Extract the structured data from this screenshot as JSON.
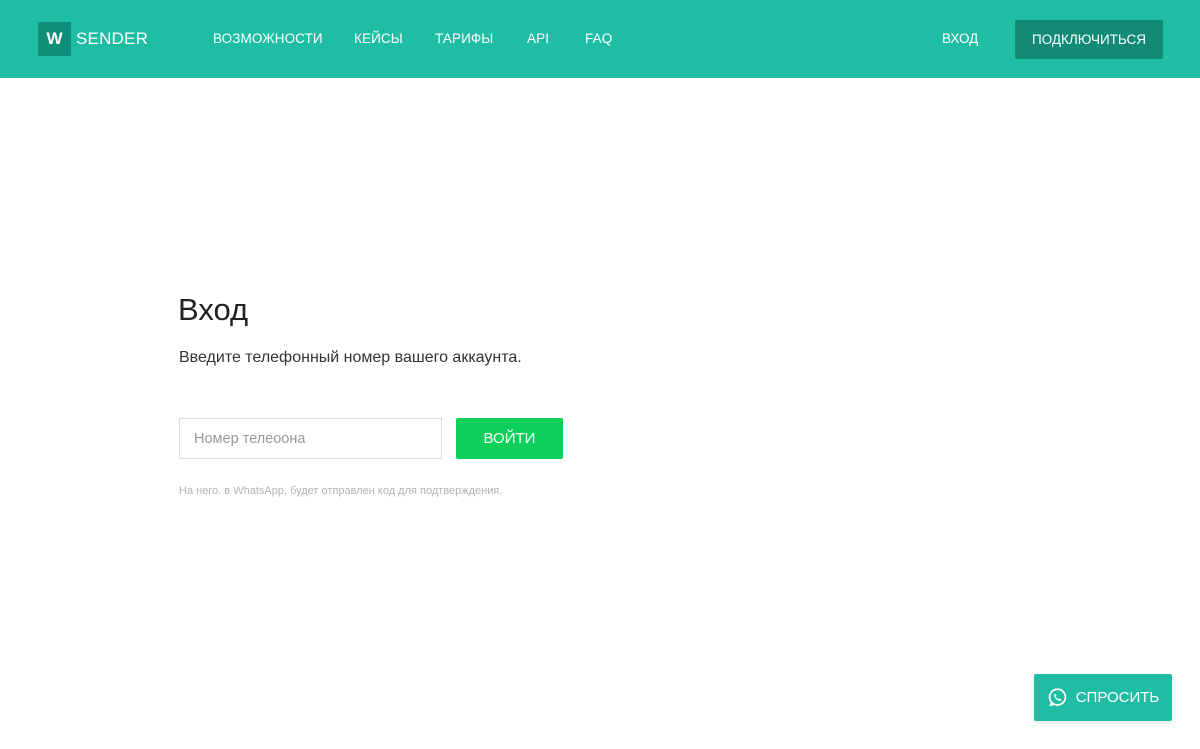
{
  "header": {
    "logo_letter": "W",
    "logo_text": "SENDER",
    "nav": [
      {
        "label": "ВОЗМОЖНОСТИ"
      },
      {
        "label": "КЕЙСЫ"
      },
      {
        "label": "ТАРИФЫ"
      },
      {
        "label": "API"
      },
      {
        "label": "FAQ"
      }
    ],
    "login_label": "ВХОД",
    "connect_label": "ПОДКЛЮЧИТЬСЯ"
  },
  "main": {
    "title": "Вход",
    "subtitle": "Введите телефонный номер вашего аккаунта.",
    "phone_placeholder": "Номер телеоона",
    "phone_value": "",
    "submit_label": "ВОЙТИ",
    "hint": "На него. в WhatsApp, будет отправлен код для подтверждения."
  },
  "floating": {
    "ask_label": "СПРОСИТЬ",
    "icon": "whatsapp-icon"
  },
  "colors": {
    "header_bg": "#1fbea4",
    "logo_box": "#0f8f79",
    "connect_bg": "#138a73",
    "submit_bg": "#0dd05a",
    "ask_bg": "#1fbea4"
  }
}
